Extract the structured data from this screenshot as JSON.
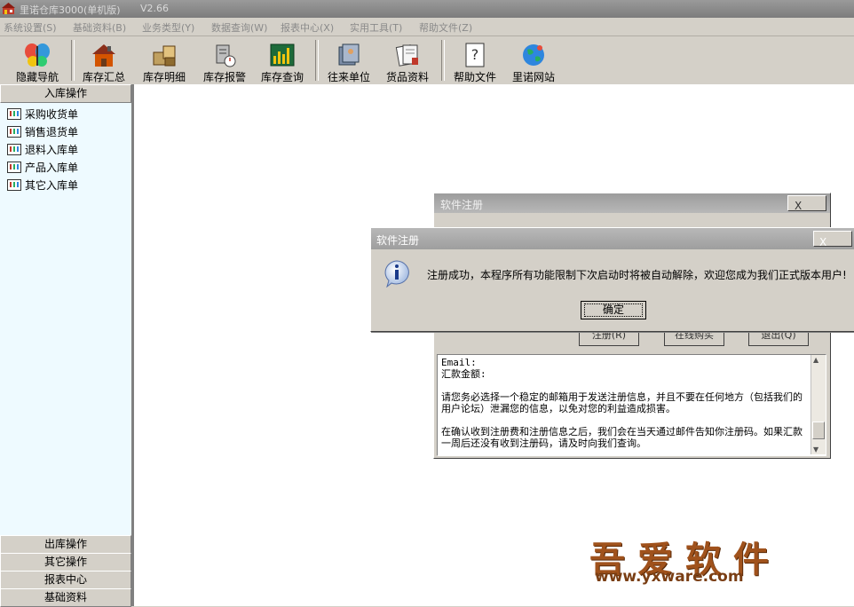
{
  "app": {
    "title": "里诺仓库3000(单机版)",
    "version": "V2.66"
  },
  "menu": [
    {
      "label": "系统设置(S)"
    },
    {
      "label": "基础资料(B)"
    },
    {
      "label": "业务类型(Y)"
    },
    {
      "label": "数据查询(W)"
    },
    {
      "label": "报表中心(X)"
    },
    {
      "label": "实用工具(T)"
    },
    {
      "label": "帮助文件(Z)"
    }
  ],
  "toolbar": [
    {
      "label": "隐藏导航",
      "icon": "butterfly-icon"
    },
    {
      "label": "库存汇总",
      "icon": "house-icon"
    },
    {
      "label": "库存明细",
      "icon": "boxes-icon"
    },
    {
      "label": "库存报警",
      "icon": "alarm-icon"
    },
    {
      "label": "库存查询",
      "icon": "chart-icon"
    },
    {
      "label": "往来单位",
      "icon": "folder-icon"
    },
    {
      "label": "货品资料",
      "icon": "documents-icon"
    },
    {
      "label": "帮助文件",
      "icon": "help-icon"
    },
    {
      "label": "里诺网站",
      "icon": "globe-icon"
    }
  ],
  "nav": {
    "active_header": "入库操作",
    "items": [
      {
        "label": "采购收货单"
      },
      {
        "label": "销售退货单"
      },
      {
        "label": "退料入库单"
      },
      {
        "label": "产品入库单"
      },
      {
        "label": "其它入库单"
      }
    ],
    "bottom_headers": [
      {
        "label": "出库操作"
      },
      {
        "label": "其它操作"
      },
      {
        "label": "报表中心"
      },
      {
        "label": "基础资料"
      }
    ]
  },
  "register_dialog": {
    "title": "软件注册",
    "close": "X",
    "buttons": [
      {
        "label": "注册(R)"
      },
      {
        "label": "在线购买"
      },
      {
        "label": "退出(Q)"
      }
    ],
    "memo_text": "Email:\n汇款金额:\n\n请您务必选择一个稳定的邮箱用于发送注册信息，并且不要在任何地方（包括我们的用户论坛）泄漏您的信息，以免对您的利益造成损害。\n\n在确认收到注册费和注册信息之后，我们会在当天通过邮件告知你注册码。如果汇款一周后还没有收到注册码，请及时向我们查询。"
  },
  "message_box": {
    "title": "软件注册",
    "close": "X",
    "message": "注册成功，本程序所有功能限制下次启动时将被自动解除，欢迎您成为我们正式版本用户!",
    "ok_label": "确定",
    "icon": "info-icon"
  },
  "watermark": {
    "title": "吾爱软件",
    "url": "www.yxware.com"
  }
}
